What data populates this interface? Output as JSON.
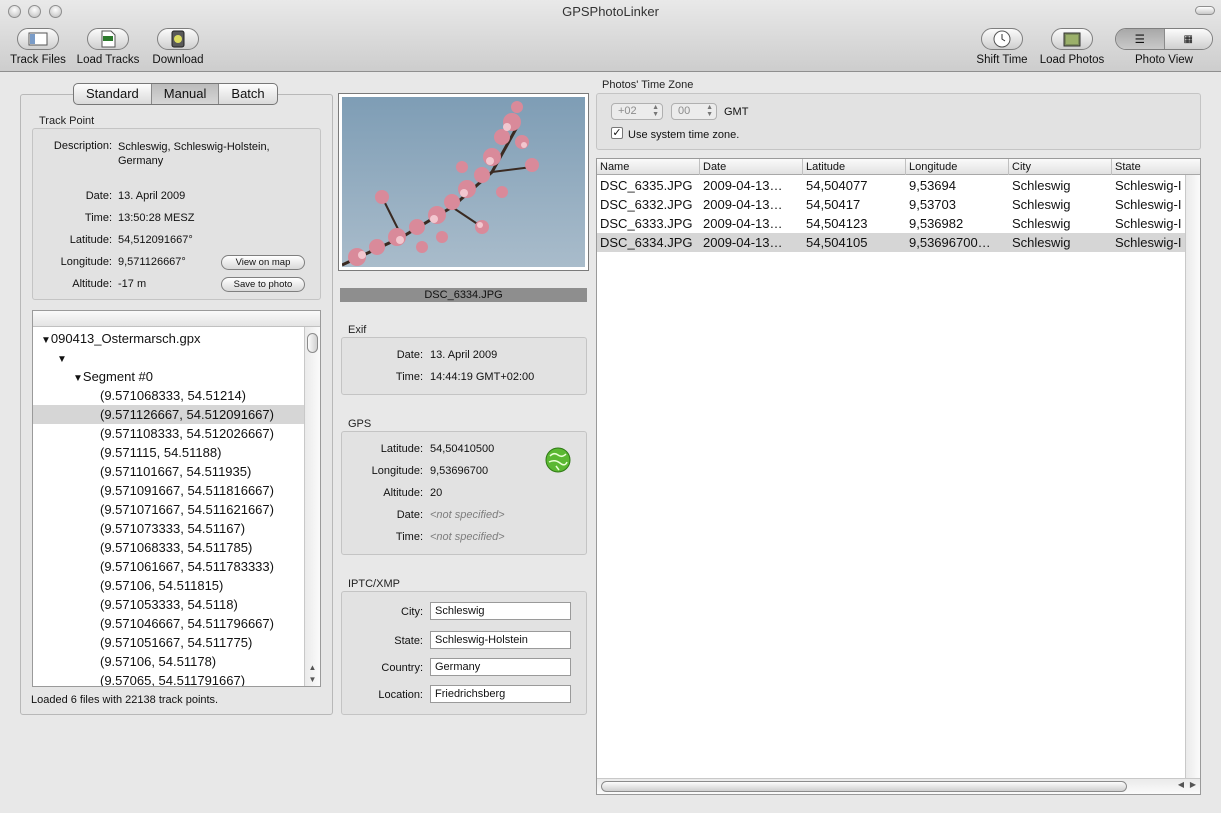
{
  "window": {
    "title": "GPSPhotoLinker"
  },
  "toolbar": {
    "track_files": "Track Files",
    "load_tracks": "Load Tracks",
    "download": "Download",
    "shift_time": "Shift Time",
    "load_photos": "Load Photos",
    "photo_view": "Photo View"
  },
  "mode_tabs": [
    "Standard",
    "Manual",
    "Batch"
  ],
  "track_point": {
    "title": "Track Point",
    "labels": {
      "description": "Description:",
      "date": "Date:",
      "time": "Time:",
      "latitude": "Latitude:",
      "longitude": "Longitude:",
      "altitude": "Altitude:"
    },
    "description": "Schleswig, Schleswig-Holstein, Germany",
    "date": "13. April 2009",
    "time": "13:50:28 MESZ",
    "latitude": "54,512091667°",
    "longitude": "9,571126667°",
    "altitude": "-17 m",
    "view_on_map": "View on map",
    "save_to_photo": "Save to photo"
  },
  "track_tree": {
    "file": "090413_Ostermarsch.gpx",
    "segment": "Segment #0",
    "points": [
      "(9.571068333, 54.51214)",
      "(9.571126667, 54.512091667)",
      "(9.571108333, 54.512026667)",
      "(9.571115, 54.51188)",
      "(9.571101667, 54.511935)",
      "(9.571091667, 54.511816667)",
      "(9.571071667, 54.511621667)",
      "(9.571073333, 54.51167)",
      "(9.571068333, 54.511785)",
      "(9.571061667, 54.511783333)",
      "(9.57106, 54.511815)",
      "(9.571053333, 54.5118)",
      "(9.571046667, 54.511796667)",
      "(9.571051667, 54.511775)",
      "(9.57106, 54.51178)",
      "(9.57065, 54.511791667)"
    ],
    "selected_index": 1
  },
  "status": "Loaded 6 files with 22138 track points.",
  "photo": {
    "filename": "DSC_6334.JPG"
  },
  "exif": {
    "title": "Exif",
    "labels": {
      "date": "Date:",
      "time": "Time:"
    },
    "date": "13. April 2009",
    "time": "14:44:19 GMT+02:00"
  },
  "gps": {
    "title": "GPS",
    "labels": {
      "latitude": "Latitude:",
      "longitude": "Longitude:",
      "altitude": "Altitude:",
      "date": "Date:",
      "time": "Time:"
    },
    "latitude": "54,50410500",
    "longitude": "9,53696700",
    "altitude": "20",
    "date": "<not specified>",
    "time": "<not specified>"
  },
  "iptc": {
    "title": "IPTC/XMP",
    "labels": {
      "city": "City:",
      "state": "State:",
      "country": "Country:",
      "location": "Location:"
    },
    "city": "Schleswig",
    "state": "Schleswig-Holstein",
    "country": "Germany",
    "location": "Friedrichsberg"
  },
  "timezone": {
    "title": "Photos' Time Zone",
    "hours": "+02",
    "minutes": "00",
    "gmt": "GMT",
    "use_system": "Use system time zone.",
    "use_system_checked": true
  },
  "photos_table": {
    "columns": [
      "Name",
      "Date",
      "Latitude",
      "Longitude",
      "City",
      "State"
    ],
    "rows": [
      [
        "DSC_6335.JPG",
        "2009-04-13…",
        "54,504077",
        "9,53694",
        "Schleswig",
        "Schleswig-I"
      ],
      [
        "DSC_6332.JPG",
        "2009-04-13…",
        "54,50417",
        "9,53703",
        "Schleswig",
        "Schleswig-I"
      ],
      [
        "DSC_6333.JPG",
        "2009-04-13…",
        "54,504123",
        "9,536982",
        "Schleswig",
        "Schleswig-I"
      ],
      [
        "DSC_6334.JPG",
        "2009-04-13…",
        "54,504105",
        "9,53696700…",
        "Schleswig",
        "Schleswig-I"
      ]
    ],
    "selected_index": 3
  }
}
